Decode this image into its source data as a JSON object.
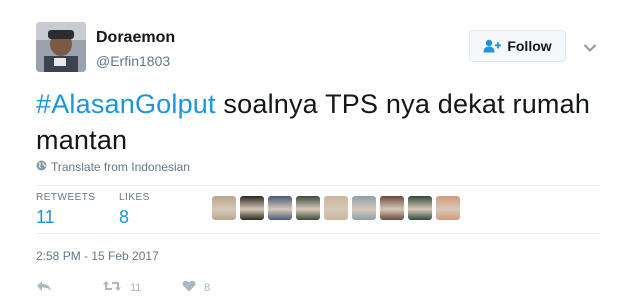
{
  "user": {
    "display_name": "Doraemon",
    "screen_name": "@Erfin1803",
    "avatar_icon": "profile-photo"
  },
  "follow": {
    "label": "Follow",
    "icon": "add-user-icon"
  },
  "tweet": {
    "hashtag": "#AlasanGolput",
    "text": " soalnya TPS nya dekat rumah mantan"
  },
  "translate": {
    "label": "Translate from Indonesian",
    "icon": "globe-icon"
  },
  "stats": {
    "retweets_label": "RETWEETS",
    "retweets_count": "11",
    "likes_label": "LIKES",
    "likes_count": "8"
  },
  "likers": [
    {
      "color": "#b7a78f"
    },
    {
      "color": "#2a2622"
    },
    {
      "color": "#4a5a7a"
    },
    {
      "color": "#3d4a3a"
    },
    {
      "color": "#c9b59a"
    },
    {
      "color": "#8aa0a8"
    },
    {
      "color": "#6a4a3a"
    },
    {
      "color": "#2f4a3a"
    },
    {
      "color": "#d49a7a"
    }
  ],
  "timestamp": "2:58 PM - 15 Feb 2017",
  "actions": {
    "retweet_count": "11",
    "like_count": "8"
  },
  "colors": {
    "accent": "#1b95e0",
    "muted": "#657786",
    "action_icon": "#aab8c2"
  }
}
